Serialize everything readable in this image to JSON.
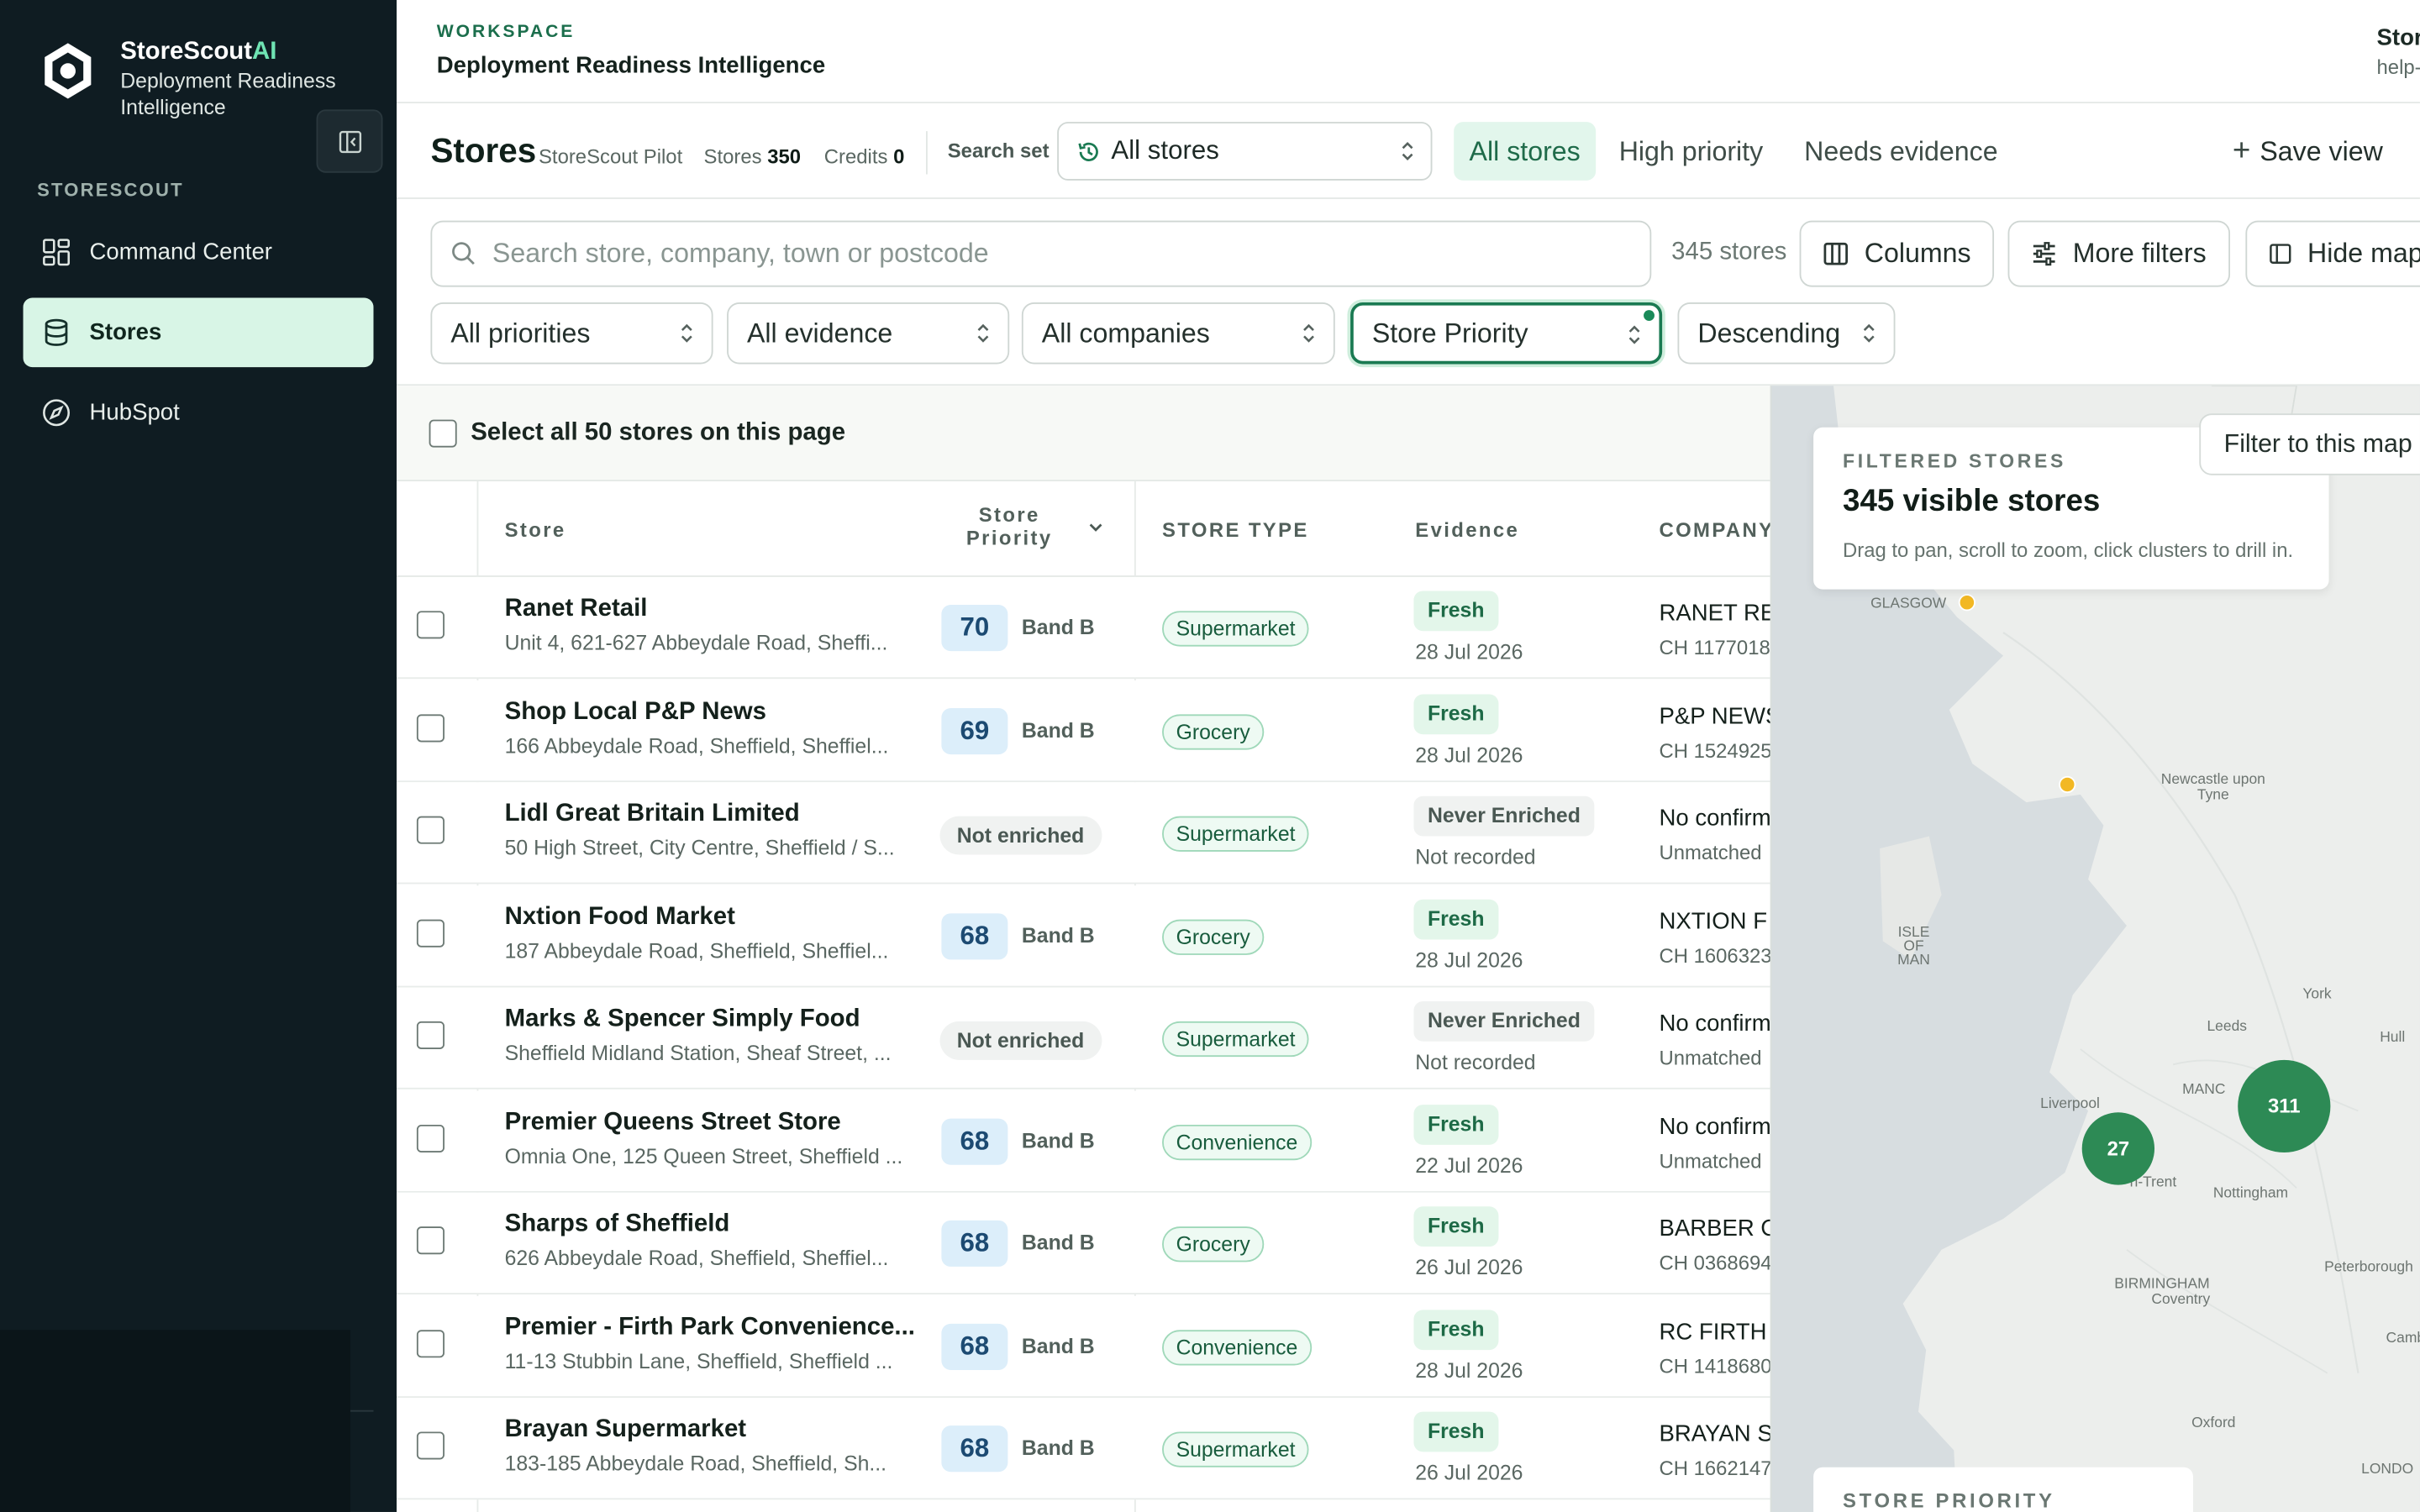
{
  "brand": {
    "name": "StoreScout",
    "name_accent": "AI",
    "subtitle": "Deployment Readiness Intelligence"
  },
  "sidebar": {
    "section_label": "STORESCOUT",
    "items": [
      {
        "label": "Command Center",
        "icon": "grid-icon",
        "active": false
      },
      {
        "label": "Stores",
        "icon": "database-icon",
        "active": true
      },
      {
        "label": "HubSpot",
        "icon": "compass-icon",
        "active": false
      }
    ]
  },
  "topbar": {
    "workspace_label": "WORKSPACE",
    "workspace_title": "Deployment Readiness Intelligence",
    "user_name": "Stor",
    "user_email": "help-c"
  },
  "header": {
    "title": "Stores",
    "project": "StoreScout Pilot",
    "stores_label": "Stores",
    "stores_count": "350",
    "credits_label": "Credits",
    "credits_count": "0",
    "search_set_label": "Search set",
    "search_set_value": "All stores",
    "tabs": [
      "All stores",
      "High priority",
      "Needs evidence"
    ],
    "save_view": "Save view"
  },
  "filters": {
    "search_placeholder": "Search store, company, town or postcode",
    "result_count": "345 stores",
    "columns": "Columns",
    "more_filters": "More filters",
    "hide_map": "Hide map",
    "priority": "All priorities",
    "evidence": "All evidence",
    "companies": "All companies",
    "sort_field": "Store Priority",
    "sort_order": "Descending"
  },
  "table": {
    "select_all": "Select all 50 stores on this page",
    "columns": {
      "store": "Store",
      "priority_line1": "Store",
      "priority_line2": "Priority",
      "store_type": "STORE TYPE",
      "evidence": "Evidence",
      "company": "COMPANY"
    },
    "rows": [
      {
        "name": "Ranet Retail",
        "address": "Unit 4, 621-627 Abbeydale Road, Sheffi...",
        "score": "70",
        "band": "Band B",
        "type": "Supermarket",
        "evidence": "Fresh",
        "evidence_date": "28 Jul 2026",
        "company": "RANET RE",
        "company_sub": "CH 1177018"
      },
      {
        "name": "Shop Local P&P News",
        "address": "166 Abbeydale Road, Sheffield, Sheffiel...",
        "score": "69",
        "band": "Band B",
        "type": "Grocery",
        "evidence": "Fresh",
        "evidence_date": "28 Jul 2026",
        "company": "P&P NEWS",
        "company_sub": "CH 1524925"
      },
      {
        "name": "Lidl Great Britain Limited",
        "address": "50 High Street, City Centre, Sheffield / S...",
        "score": "Not enriched",
        "band": "",
        "type": "Supermarket",
        "evidence": "Never Enriched",
        "evidence_date": "Not recorded",
        "company": "No confirm",
        "company_sub": "Unmatched"
      },
      {
        "name": "Nxtion Food Market",
        "address": "187 Abbeydale Road, Sheffield, Sheffiel...",
        "score": "68",
        "band": "Band B",
        "type": "Grocery",
        "evidence": "Fresh",
        "evidence_date": "28 Jul 2026",
        "company": "NXTION F",
        "company_sub": "CH 1606323"
      },
      {
        "name": "Marks & Spencer Simply Food",
        "address": "Sheffield Midland Station, Sheaf Street, ...",
        "score": "Not enriched",
        "band": "",
        "type": "Supermarket",
        "evidence": "Never Enriched",
        "evidence_date": "Not recorded",
        "company": "No confirm",
        "company_sub": "Unmatched"
      },
      {
        "name": "Premier Queens Street Store",
        "address": "Omnia One, 125 Queen Street, Sheffield ...",
        "score": "68",
        "band": "Band B",
        "type": "Convenience",
        "evidence": "Fresh",
        "evidence_date": "22 Jul 2026",
        "company": "No confirm",
        "company_sub": "Unmatched"
      },
      {
        "name": "Sharps of Sheffield",
        "address": "626 Abbeydale Road, Sheffield, Sheffiel...",
        "score": "68",
        "band": "Band B",
        "type": "Grocery",
        "evidence": "Fresh",
        "evidence_date": "26 Jul 2026",
        "company": "BARBER O",
        "company_sub": "CH 0368694"
      },
      {
        "name": "Premier - Firth Park Convenience...",
        "address": "11-13 Stubbin Lane, Sheffield, Sheffield ...",
        "score": "68",
        "band": "Band B",
        "type": "Convenience",
        "evidence": "Fresh",
        "evidence_date": "28 Jul 2026",
        "company": "RC FIRTH",
        "company_sub": "CH 1418680"
      },
      {
        "name": "Brayan Supermarket",
        "address": "183-185 Abbeydale Road, Sheffield, Sh...",
        "score": "68",
        "band": "Band B",
        "type": "Supermarket",
        "evidence": "Fresh",
        "evidence_date": "26 Jul 2026",
        "company": "BRAYAN S",
        "company_sub": "CH 1662147"
      }
    ]
  },
  "map": {
    "filter_button": "Filter to this map",
    "card_label": "FILTERED STORES",
    "card_title": "345 visible stores",
    "card_hint": "Drag to pan, scroll to zoom, click clusters to drill in.",
    "clusters": [
      "311",
      "27"
    ],
    "places": [
      "GLASGOW",
      "Newcastle upon Tyne",
      "ISLE OF MAN",
      "York",
      "Leeds",
      "Hull",
      "Liverpool",
      "MANC",
      "n-Trent",
      "Nottingham",
      "BIRMINGHAM",
      "Coventry",
      "Peterborough",
      "Camb",
      "Oxford",
      "LONDO"
    ],
    "legend_label": "STORE PRIORITY"
  },
  "colors": {
    "sidebar_bg": "#0f1c22",
    "accent": "#1a7a52",
    "active_nav": "#d8f5e6",
    "cluster": "#2d8a55",
    "marker": "#f2b824"
  }
}
